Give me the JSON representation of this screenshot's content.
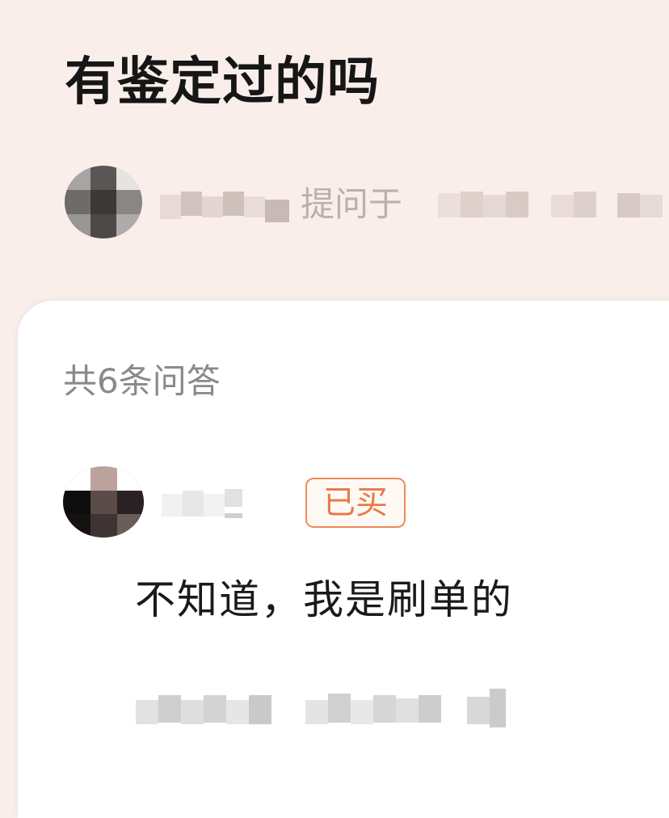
{
  "question": {
    "title": "有鉴定过的吗",
    "asked_at_label": "提问于"
  },
  "answers": {
    "count_label": "共6条问答",
    "items": [
      {
        "purchased_badge": "已买",
        "text": "不知道，我是刷单的"
      }
    ]
  },
  "colors": {
    "header_bg": "#f9eeea",
    "card_bg": "#ffffff",
    "badge": "#ea7a48"
  }
}
